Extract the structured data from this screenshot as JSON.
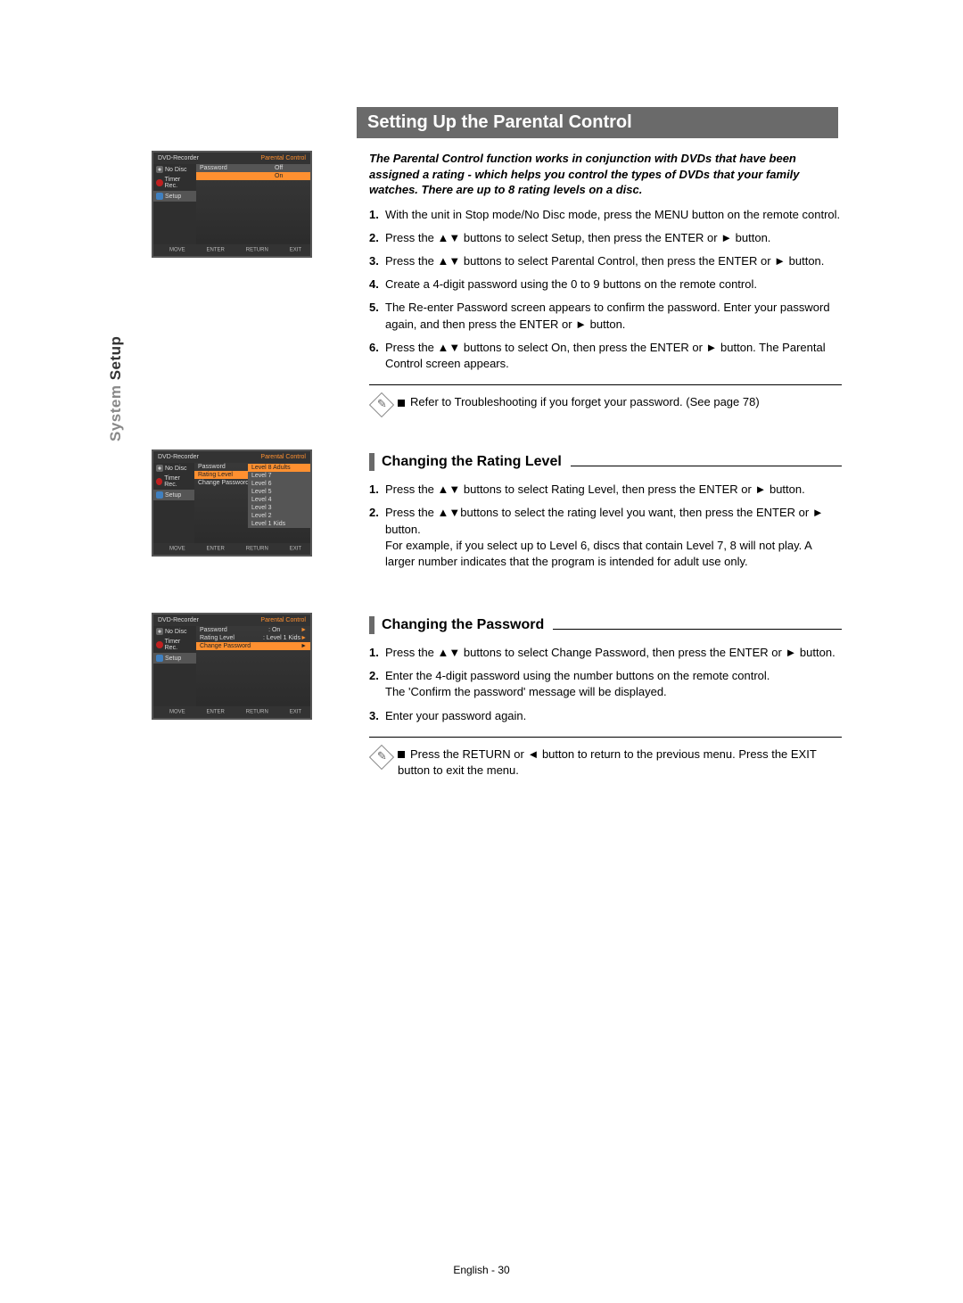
{
  "sidebar_label_light": "System ",
  "sidebar_label_dark": "Setup",
  "main_title": "Setting Up the Parental Control",
  "intro": "The Parental Control function works in conjunction with DVDs that have been assigned a rating - which helps you control the types of DVDs that your family watches. There are up to 8 rating levels on a disc.",
  "steps_main": [
    "With the unit in Stop mode/No Disc mode, press the MENU button on the remote control.",
    "Press the ▲▼ buttons to select Setup, then press the ENTER or ► button.",
    "Press the ▲▼ buttons to select Parental Control, then press the ENTER or ► button.",
    "Create a 4-digit password using the 0 to 9 buttons on the remote control.",
    "The Re-enter Password screen appears to confirm the password. Enter your password again, and then press the ENTER or ► button.",
    "Press the ▲▼ buttons to select On, then press the ENTER or ► button. The Parental Control screen appears."
  ],
  "note1": "Refer to Troubleshooting if you forget your password. (See page 78)",
  "sub1_title": "Changing the Rating Level",
  "steps_rating": [
    "Press the ▲▼ buttons to select Rating Level, then press the ENTER or ► button.",
    "Press the ▲▼buttons to select the rating level you want, then press the ENTER or ► button.\nFor example, if you select up to Level 6, discs that contain Level 7, 8 will not play. A larger number indicates that the program is intended for adult use only."
  ],
  "sub2_title": "Changing the Password",
  "steps_password": [
    "Press the ▲▼ buttons to select Change Password, then press the ENTER or ► button.",
    "Enter the 4-digit password using the number buttons on the remote control.\nThe 'Confirm the password' message will be displayed.",
    "Enter your password again."
  ],
  "note2": "Press the RETURN or ◄ button to return to the previous menu. Press the EXIT button to exit the menu.",
  "footer": "English - 30",
  "osd": {
    "header_left": "DVD-Recorder",
    "header_right": "Parental Control",
    "nav": {
      "no_disc": "No Disc",
      "timer": "Timer Rec.",
      "setup": "Setup"
    },
    "labels": {
      "password": "Password",
      "rating_level": "Rating Level",
      "change_password": "Change Password"
    },
    "values": {
      "off": "Off",
      "on": "On",
      "on_colon": ": On",
      "level1kids_colon": ": Level 1 Kids"
    },
    "levels": [
      "Level  8 Adults",
      "Level  7",
      "Level  6",
      "Level  5",
      "Level  4",
      "Level  3",
      "Level  2",
      "Level  1 Kids"
    ],
    "footer": {
      "move": "MOVE",
      "enter": "ENTER",
      "return": "RETURN",
      "exit": "EXIT"
    }
  }
}
